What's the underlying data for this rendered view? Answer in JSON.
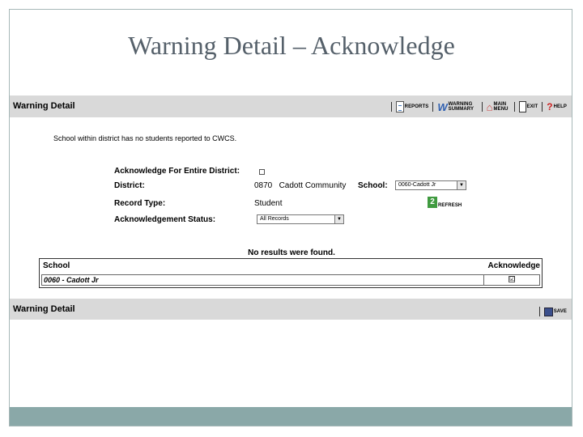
{
  "slide": {
    "title": "Warning Detail – Acknowledge"
  },
  "top_bar": {
    "label": "Warning Detail",
    "buttons": [
      {
        "label": "REPORTS",
        "icon": "document-icon"
      },
      {
        "label": "WARNING SUMMARY",
        "icon": "word-doc-icon"
      },
      {
        "label": "MAIN MENU",
        "icon": "house-icon"
      },
      {
        "label": "EXIT",
        "icon": "door-icon"
      },
      {
        "label": "HELP",
        "icon": "question-icon"
      }
    ]
  },
  "message": "School within district has no students reported to CWCS.",
  "form": {
    "acknowledge_district_label": "Acknowledge For Entire District:",
    "district_label": "District:",
    "district_value": "0870   Cadott Community",
    "school_label": "School:",
    "school_selected": "0060-Cadott Jr",
    "record_type_label": "Record Type:",
    "record_type_value": "Student",
    "refresh_label": "REFRESH",
    "ack_status_label": "Acknowledgement Status:",
    "ack_status_selected": "All Records"
  },
  "results": {
    "message": "No results were found.",
    "columns": [
      "School",
      "Acknowledge"
    ],
    "rows": [
      {
        "school": "0060 - Cadott Jr",
        "acknowledged": "☑"
      }
    ]
  },
  "bottom_bar": {
    "label": "Warning Detail",
    "save_label": "SAVE"
  },
  "colors": {
    "bar": "#d9d9d9",
    "footer_band": "#8aa8a8",
    "title": "#55606a"
  }
}
